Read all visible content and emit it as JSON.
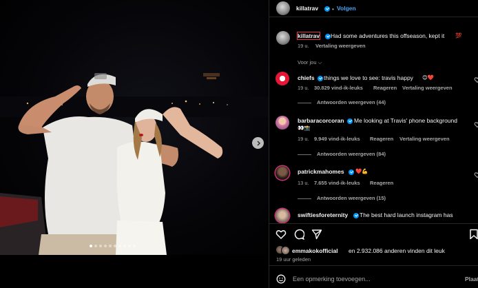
{
  "post": {
    "author": "killatrav",
    "follow_label": "Volgen",
    "caption_author": "killatrav",
    "caption": "Had some adventures this offseason, kept it",
    "caption_emoji": "💯",
    "caption_time": "19 u.",
    "translate": "Vertaling weergeven",
    "for_you": "Voor jou",
    "carousel_index": 1,
    "carousel_count": 10
  },
  "comments": [
    {
      "user": "chiefs",
      "text": "things we love to see: travis happy",
      "emoji": "😊❤️",
      "time": "19 u.",
      "likes": "30.829 vind-ik-leuks",
      "reply": "Reageren",
      "translate": "Vertaling weergeven",
      "replies": "Antwoorden weergeven (44)"
    },
    {
      "user": "barbaracorcoran",
      "text": "Me looking at Travis' phone background",
      "emoji": "👀📸",
      "time": "19 u.",
      "likes": "9.949 vind-ik-leuks",
      "reply": "Reageren",
      "translate": "Vertaling weergeven",
      "replies": "Antwoorden weergeven (84)"
    },
    {
      "user": "patrickmahomes",
      "text": "",
      "emoji": "❤️💪",
      "time": "13 u.",
      "likes": "7.655 vind-ik-leuks",
      "reply": "Reageren",
      "translate": "",
      "replies": "Antwoorden weergeven (15)"
    },
    {
      "user": "swiftiesforeternity",
      "text": "The best hard launch instagram has",
      "emoji": "",
      "time": "",
      "likes": "",
      "reply": "",
      "translate": "",
      "replies": ""
    }
  ],
  "footer": {
    "likes_user": "emmakokofficial",
    "likes_rest": "en 2.932.086 anderen vinden dit leuk",
    "time": "19 uur geleden",
    "comment_placeholder": "Een opmerking toevoegen...",
    "post_label": "Plaatsen"
  },
  "icons": {
    "next": "chevron-right-icon",
    "heart": "heart-icon",
    "comment": "comment-icon",
    "share": "share-icon",
    "save": "bookmark-icon",
    "emoji": "emoji-icon",
    "verified": "verified-badge-icon"
  },
  "colors": {
    "accent": "#0095f6",
    "follow": "#4aa3f5",
    "muted": "#a8a8a8",
    "background": "#000000"
  }
}
